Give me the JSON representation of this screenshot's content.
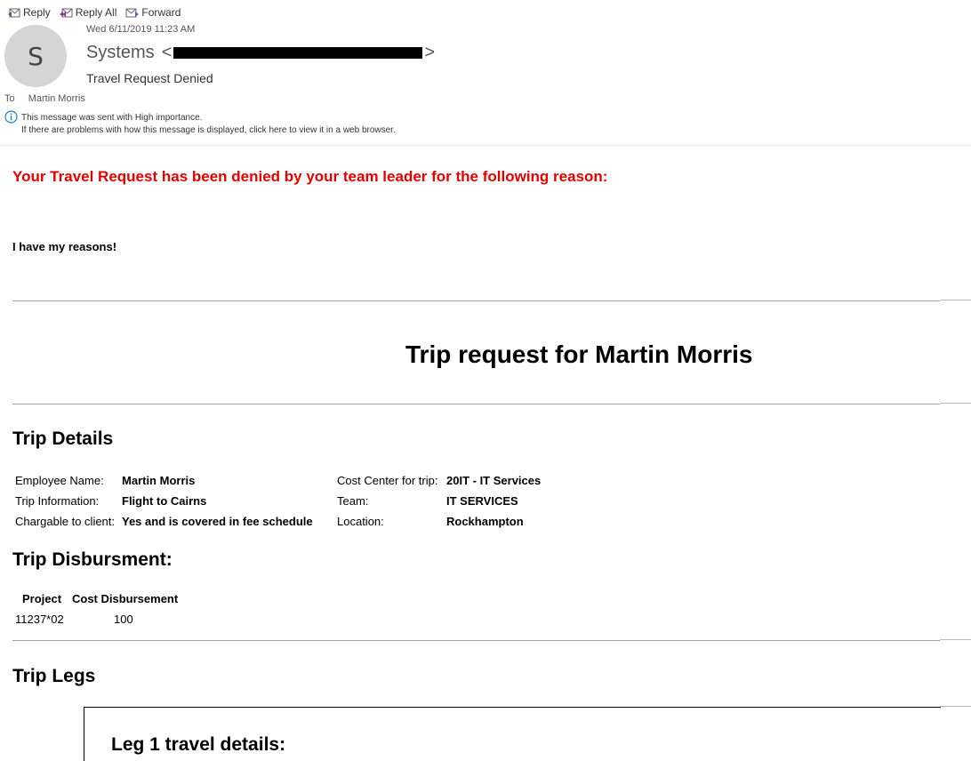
{
  "toolbar": {
    "reply": "Reply",
    "reply_all": "Reply All",
    "forward": "Forward"
  },
  "header": {
    "avatar_initial": "S",
    "date": "Wed 6/11/2019 11:23 AM",
    "sender_name": "Systems",
    "sender_open": "<",
    "sender_close": ">",
    "subject": "Travel Request Denied",
    "to_label": "To",
    "to_name": "Martin Morris",
    "importance_line1": "This message was sent with High importance.",
    "importance_line2": "If there are problems with how this message is displayed, click here to view it in a web browser."
  },
  "body": {
    "denied_message": "Your Travel Request has been denied by your team leader for the following reason:",
    "reason": "I have my reasons!",
    "trip_title": "Trip request for Martin Morris",
    "trip_details_heading": "Trip Details",
    "details": {
      "employee_name_label": "Employee Name:",
      "employee_name": "Martin Morris",
      "trip_info_label": "Trip Information:",
      "trip_info": "Flight to Cairns",
      "chargeable_label": "Chargable to client:",
      "chargeable": "Yes and is covered in fee schedule",
      "cost_center_label": "Cost Center for trip:",
      "cost_center": "20IT - IT Services",
      "team_label": "Team:",
      "team": "IT SERVICES",
      "location_label": "Location:",
      "location": "Rockhampton"
    },
    "disbursement_heading": "Trip Disbursment:",
    "disbursement": {
      "headers": [
        "Project",
        "Cost Disbursement"
      ],
      "rows": [
        [
          "11237*02",
          "100"
        ]
      ]
    },
    "legs_heading": "Trip Legs",
    "leg1_title": "Leg 1 travel details:"
  },
  "colors": {
    "denied_text": "#e00000",
    "info_icon": "#1e7fc8"
  },
  "icons": {
    "reply": "reply-icon",
    "reply_all": "reply-all-icon",
    "forward": "forward-icon",
    "info": "info-icon"
  }
}
